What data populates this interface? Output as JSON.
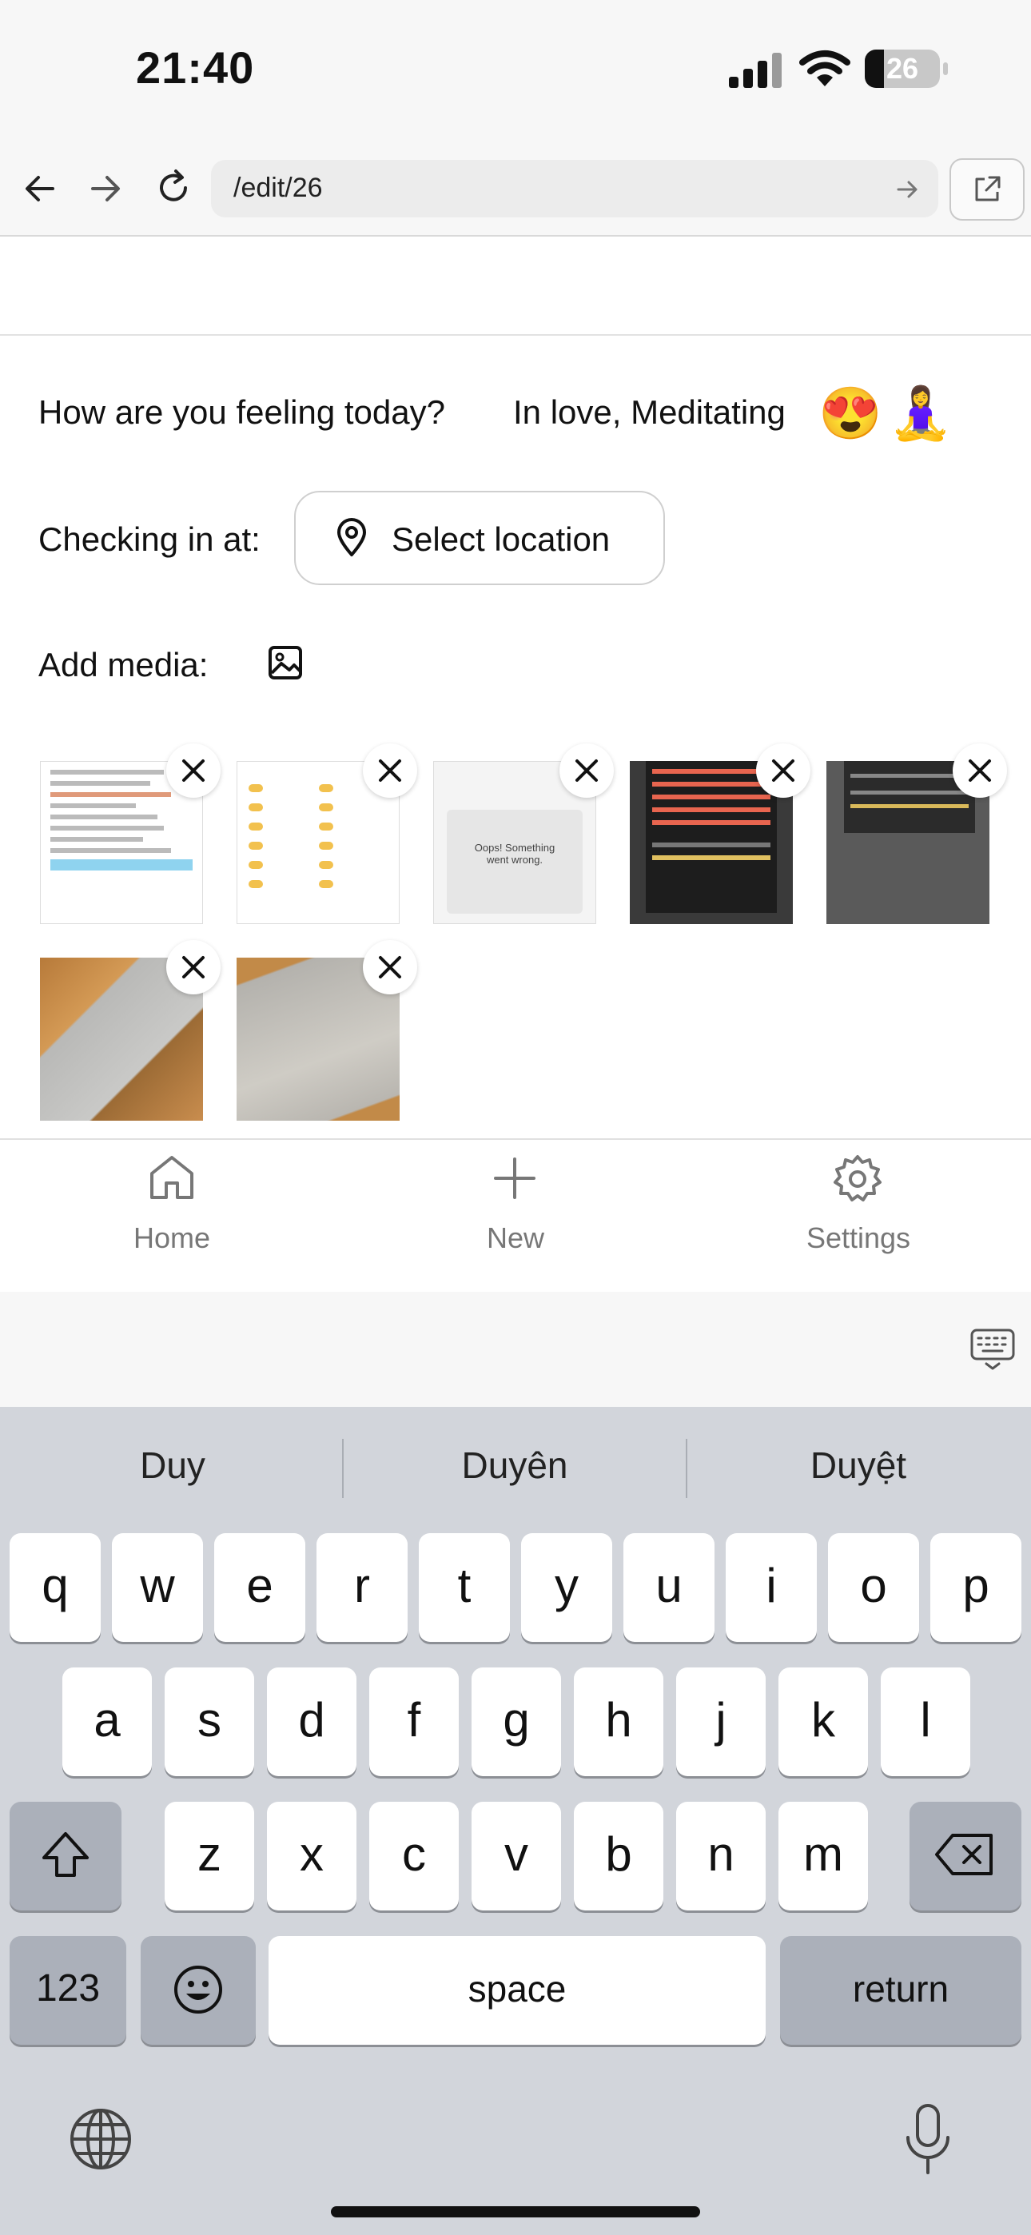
{
  "status_bar": {
    "time": "21:40",
    "battery": "26"
  },
  "browser": {
    "url": "/edit/26"
  },
  "form": {
    "feeling_label": "How are you feeling today?",
    "feeling_value": "In love, Meditating",
    "feeling_emojis": [
      "😍",
      "🧘‍♀️"
    ],
    "location_label": "Checking in at:",
    "location_button": "Select location",
    "media_label": "Add media:"
  },
  "media_thumbs": {
    "t3_text": "Oops! Something went wrong.",
    "count": 7
  },
  "tabbar": {
    "home": "Home",
    "new": "New",
    "settings": "Settings"
  },
  "keyboard": {
    "suggestions": [
      "Duy",
      "Duyên",
      "Duyệt"
    ],
    "row1": [
      "q",
      "w",
      "e",
      "r",
      "t",
      "y",
      "u",
      "i",
      "o",
      "p"
    ],
    "row2": [
      "a",
      "s",
      "d",
      "f",
      "g",
      "h",
      "j",
      "k",
      "l"
    ],
    "row3": [
      "z",
      "x",
      "c",
      "v",
      "b",
      "n",
      "m"
    ],
    "numbers_key": "123",
    "space_key": "space",
    "return_key": "return"
  }
}
